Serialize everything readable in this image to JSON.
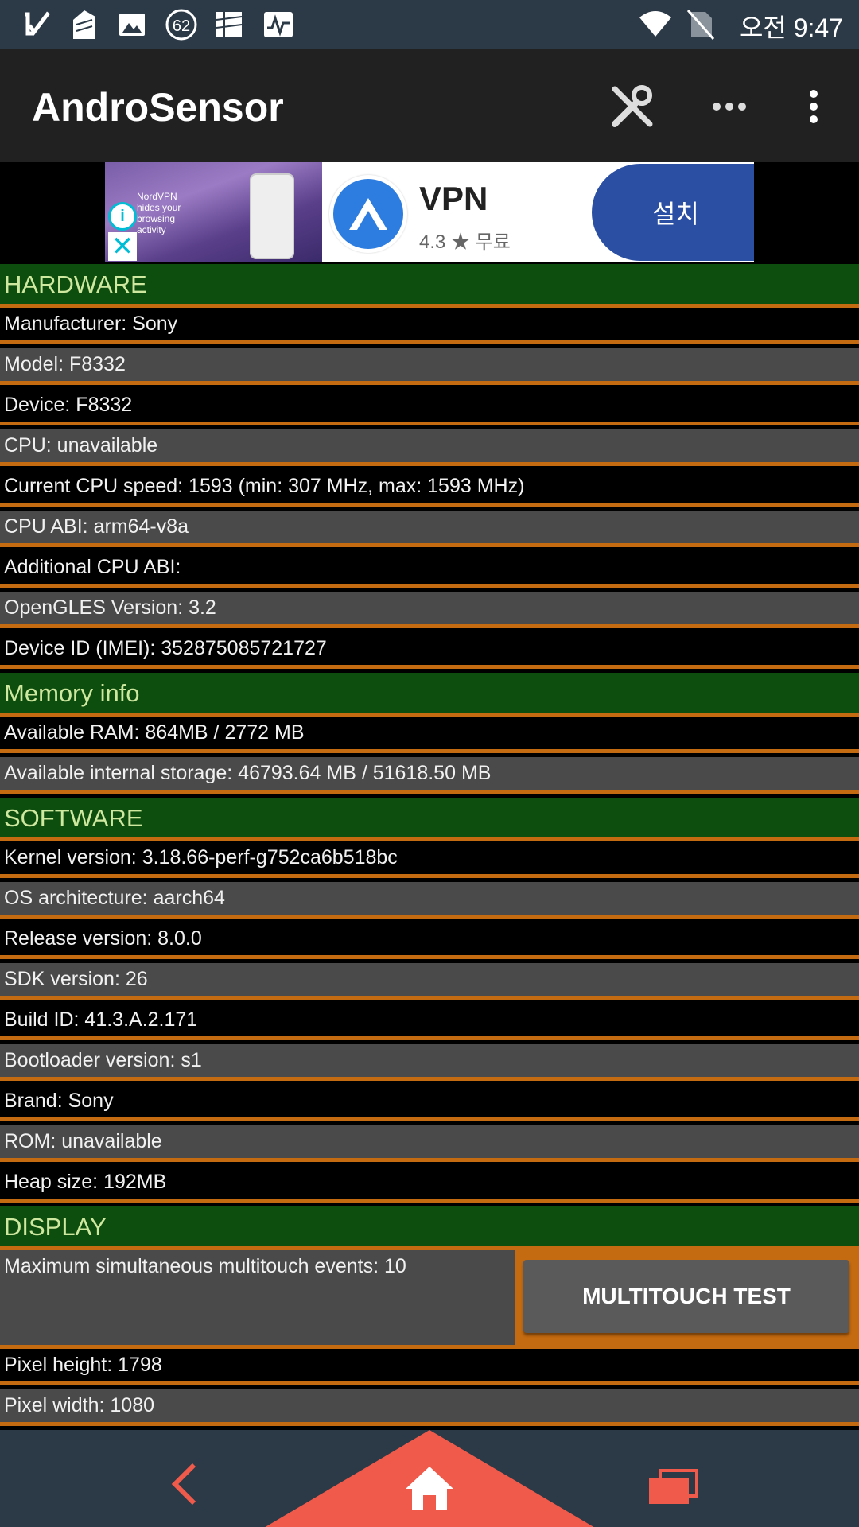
{
  "status_bar": {
    "time": "오전 9:47",
    "notification_badge": "62",
    "icons": [
      "checkmark-icon",
      "document-icon",
      "image-icon",
      "badge-icon",
      "sim-icon",
      "activity-icon",
      "wifi-icon",
      "no-sim-icon"
    ]
  },
  "app_bar": {
    "title": "AndroSensor",
    "icons": [
      "tools-icon",
      "more-horizontal-icon",
      "more-vertical-icon"
    ]
  },
  "ad": {
    "image_text": "NordVPN hides your browsing activity",
    "app_name": "VPN",
    "rating": "4.3 ★ 무료",
    "install_label": "설치"
  },
  "sections": [
    {
      "type": "header",
      "text": "HARDWARE"
    },
    {
      "type": "row",
      "text": "Manufacturer: Sony"
    },
    {
      "type": "row",
      "text": "Model: F8332"
    },
    {
      "type": "row",
      "text": "Device: F8332"
    },
    {
      "type": "row",
      "text": "CPU: unavailable"
    },
    {
      "type": "row",
      "text": "Current CPU speed: 1593 (min: 307 MHz, max: 1593 MHz)"
    },
    {
      "type": "row",
      "text": "CPU ABI: arm64-v8a"
    },
    {
      "type": "row",
      "text": "Additional CPU ABI:"
    },
    {
      "type": "row",
      "text": "OpenGLES Version: 3.2"
    },
    {
      "type": "row",
      "text": "Device ID (IMEI): 352875085721727"
    },
    {
      "type": "header",
      "text": "Memory info"
    },
    {
      "type": "row",
      "text": "Available RAM: 864MB / 2772 MB"
    },
    {
      "type": "row",
      "text": "Available internal storage: 46793.64 MB / 51618.50 MB"
    },
    {
      "type": "header",
      "text": "SOFTWARE"
    },
    {
      "type": "row",
      "text": "Kernel version: 3.18.66-perf-g752ca6b518bc"
    },
    {
      "type": "row",
      "text": "OS architecture: aarch64"
    },
    {
      "type": "row",
      "text": "Release version: 8.0.0"
    },
    {
      "type": "row",
      "text": "SDK version: 26"
    },
    {
      "type": "row",
      "text": "Build ID: 41.3.A.2.171"
    },
    {
      "type": "row",
      "text": "Bootloader version: s1"
    },
    {
      "type": "row",
      "text": "Brand: Sony"
    },
    {
      "type": "row",
      "text": "ROM: unavailable"
    },
    {
      "type": "row",
      "text": "Heap size: 192MB"
    },
    {
      "type": "header",
      "text": "DISPLAY"
    },
    {
      "type": "multitouch",
      "text": "Maximum simultaneous multitouch events: 10",
      "button_label": "MULTITOUCH TEST"
    },
    {
      "type": "row",
      "text": "Pixel height: 1798"
    },
    {
      "type": "row",
      "text": "Pixel width: 1080"
    }
  ],
  "nav_bar": {
    "icons": [
      "back-icon",
      "home-icon",
      "recents-icon"
    ]
  },
  "colors": {
    "header_bg": "#0d4d0d",
    "header_text": "#cfe8a0",
    "divider": "#c46a10",
    "row_dark": "#000000",
    "row_light": "#4a4a4a",
    "nav_accent": "#f05a4a",
    "status_bg": "#2c3a47"
  }
}
